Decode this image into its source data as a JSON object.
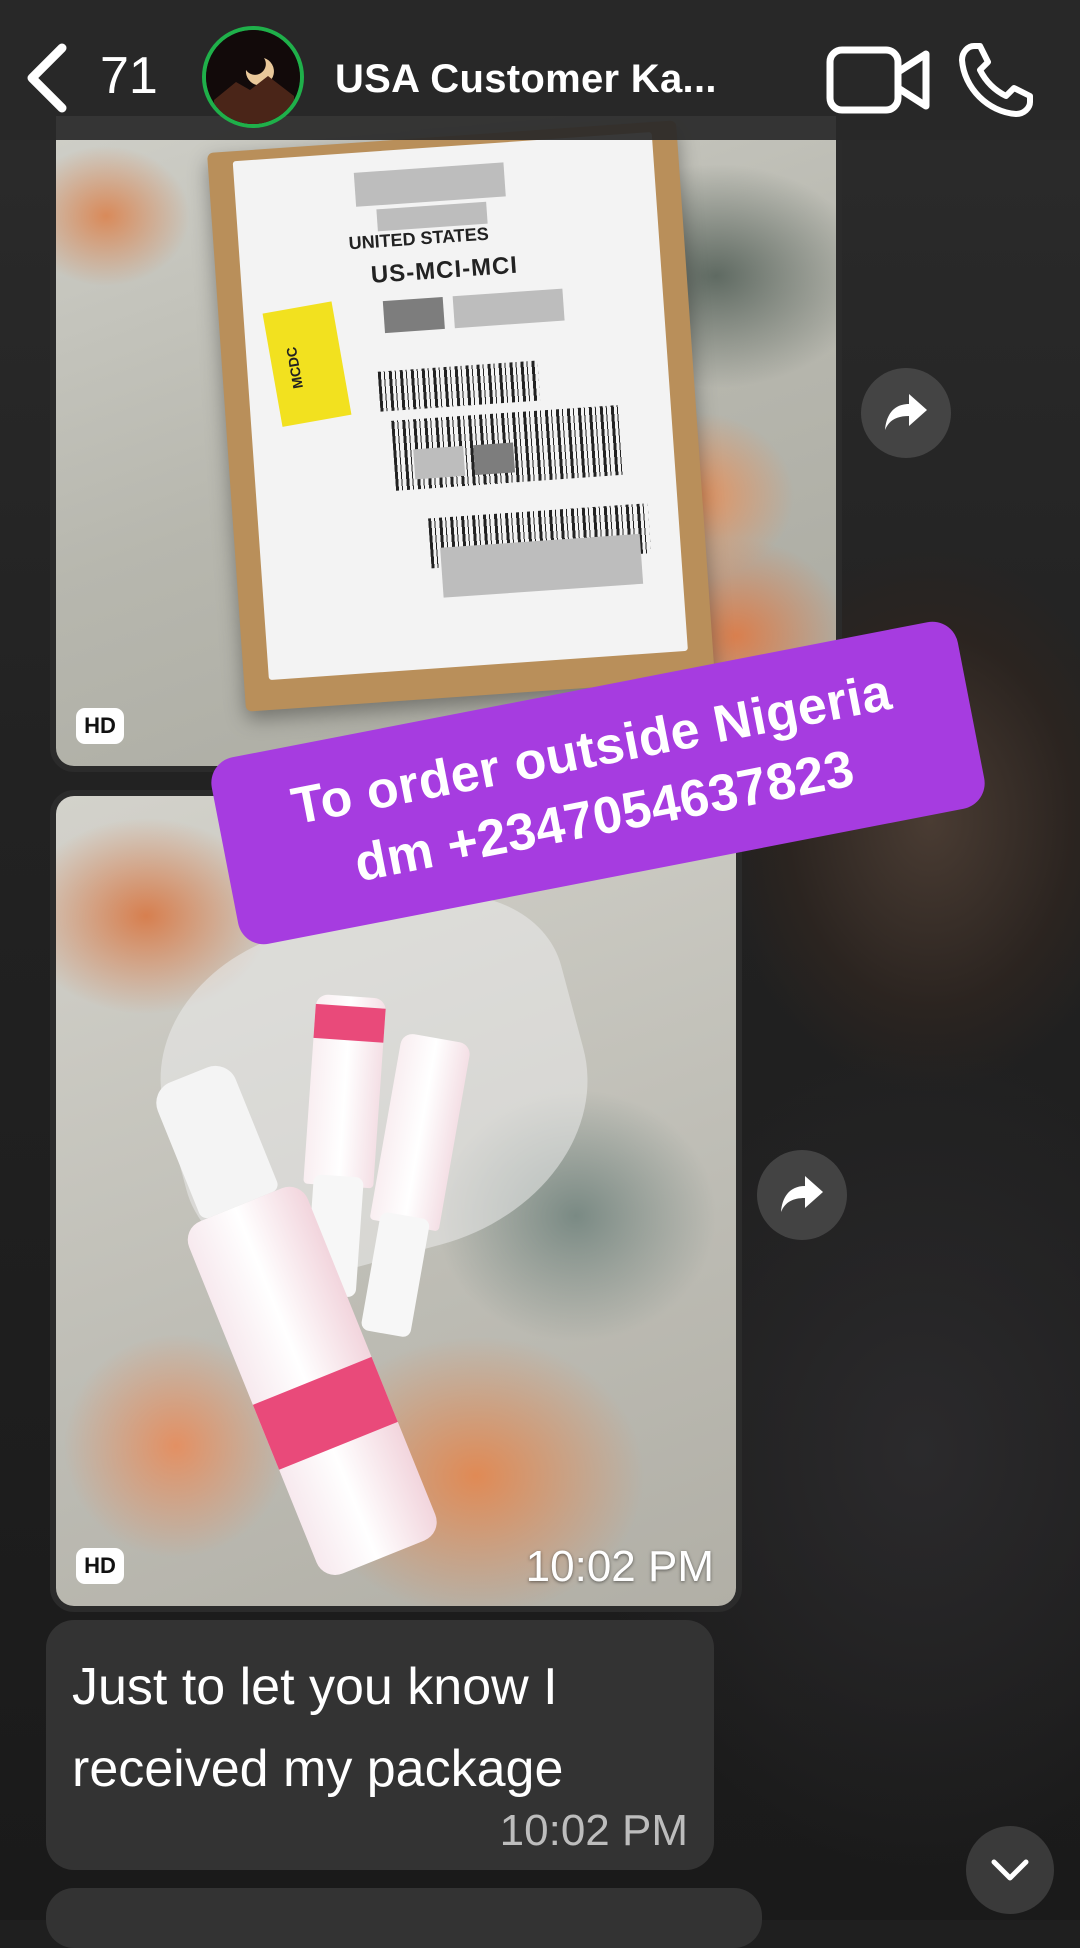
{
  "header": {
    "unread_count": "71",
    "contact_name": "USA Customer Ka...",
    "icons": [
      "back-chevron-icon",
      "video-call-icon",
      "phone-call-icon"
    ]
  },
  "messages": [
    {
      "type": "image",
      "quality_badge": "HD",
      "content": "photo-shipping-package",
      "visible_label_text": [
        "UNITED STATES",
        "US-MCI-MCI",
        "MCDC"
      ]
    },
    {
      "type": "image",
      "quality_badge": "HD",
      "time": "10:02 PM",
      "content": "photo-skincare-bottles"
    },
    {
      "type": "text",
      "text": "Just to let you know I received my package",
      "time": "10:02 PM"
    }
  ],
  "promo_overlay": {
    "line1": "To order outside Nigeria",
    "line2": "dm +2347054637823",
    "color": "#a63ce0"
  },
  "colors": {
    "header_bg": "#282828",
    "bubble_bg": "#333333",
    "avatar_ring": "#1fb04a"
  }
}
